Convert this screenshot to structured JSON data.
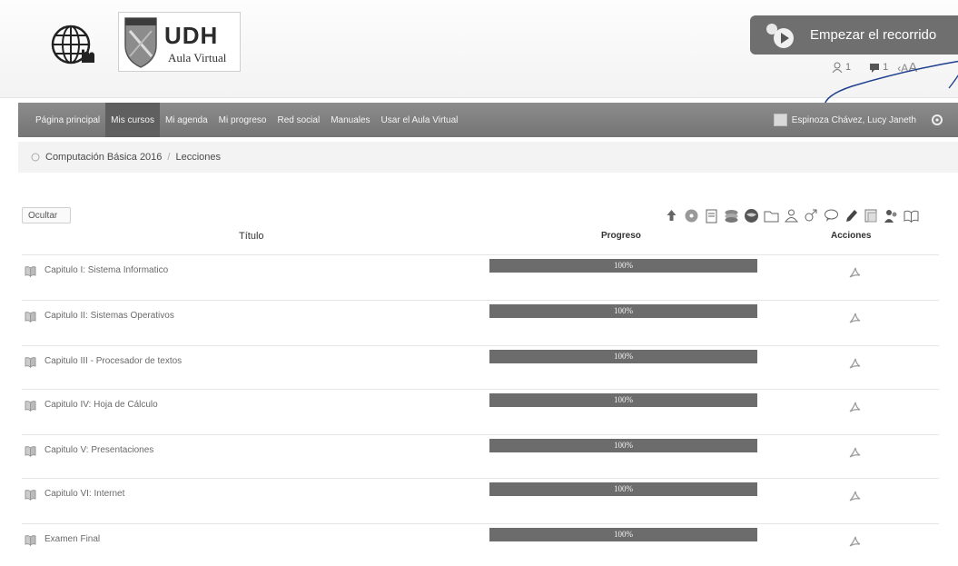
{
  "header": {
    "logo_text": "UDH",
    "logo_subtitle": "Aula Virtual",
    "tour_button_label": "Empezar el recorrido",
    "notifications_count": "1",
    "messages_count": "1",
    "font_size_small": "A",
    "font_size_large": "A",
    "font_size_prefix": "‹"
  },
  "navbar": {
    "items": [
      {
        "label": "Página principal",
        "active": false
      },
      {
        "label": "Mis cursos",
        "active": true
      },
      {
        "label": "Mi agenda",
        "active": false
      },
      {
        "label": "Mi progreso",
        "active": false
      },
      {
        "label": "Red social",
        "active": false
      },
      {
        "label": "Manuales",
        "active": false
      },
      {
        "label": "Usar el Aula Virtual",
        "active": false
      }
    ],
    "user_name": "Espinoza Chávez, Lucy Janeth"
  },
  "breadcrumb": {
    "course": "Computación Básica 2016",
    "separator": "/",
    "current": "Lecciones"
  },
  "toolbar": {
    "icons": [
      "upload-icon",
      "disc-icon",
      "document-icon",
      "stack-icon",
      "globe-icon",
      "folder-icon",
      "users-icon",
      "gender-icon",
      "chat-icon",
      "pencil-icon",
      "report-icon",
      "group-icon",
      "book-open-icon"
    ]
  },
  "lessons": {
    "hide_label": "Ocultar",
    "columns": {
      "title": "Título",
      "progress": "Progreso",
      "actions": "Acciones"
    },
    "rows": [
      {
        "title": "Capitulo I: Sistema Informatico",
        "progress_label": "100%",
        "progress": 1.0
      },
      {
        "title": "Capitulo II: Sistemas Operativos",
        "progress_label": "100%",
        "progress": 1.0
      },
      {
        "title": "Capitulo III - Procesador de textos",
        "progress_label": "100%",
        "progress": 1.0
      },
      {
        "title": "Capitulo IV: Hoja de Cálculo",
        "progress_label": "100%",
        "progress": 1.0
      },
      {
        "title": "Capitulo V: Presentaciones",
        "progress_label": "100%",
        "progress": 1.0
      },
      {
        "title": "Capitulo VI: Internet",
        "progress_label": "100%",
        "progress": 1.0
      },
      {
        "title": "Examen Final",
        "progress_label": "100%",
        "progress": 1.0
      }
    ]
  },
  "colors": {
    "navbar": "#808080",
    "nav_active": "#5f5f5f",
    "progress_fill": "#6c6c6c",
    "tour_button": "#6f6f6f"
  }
}
